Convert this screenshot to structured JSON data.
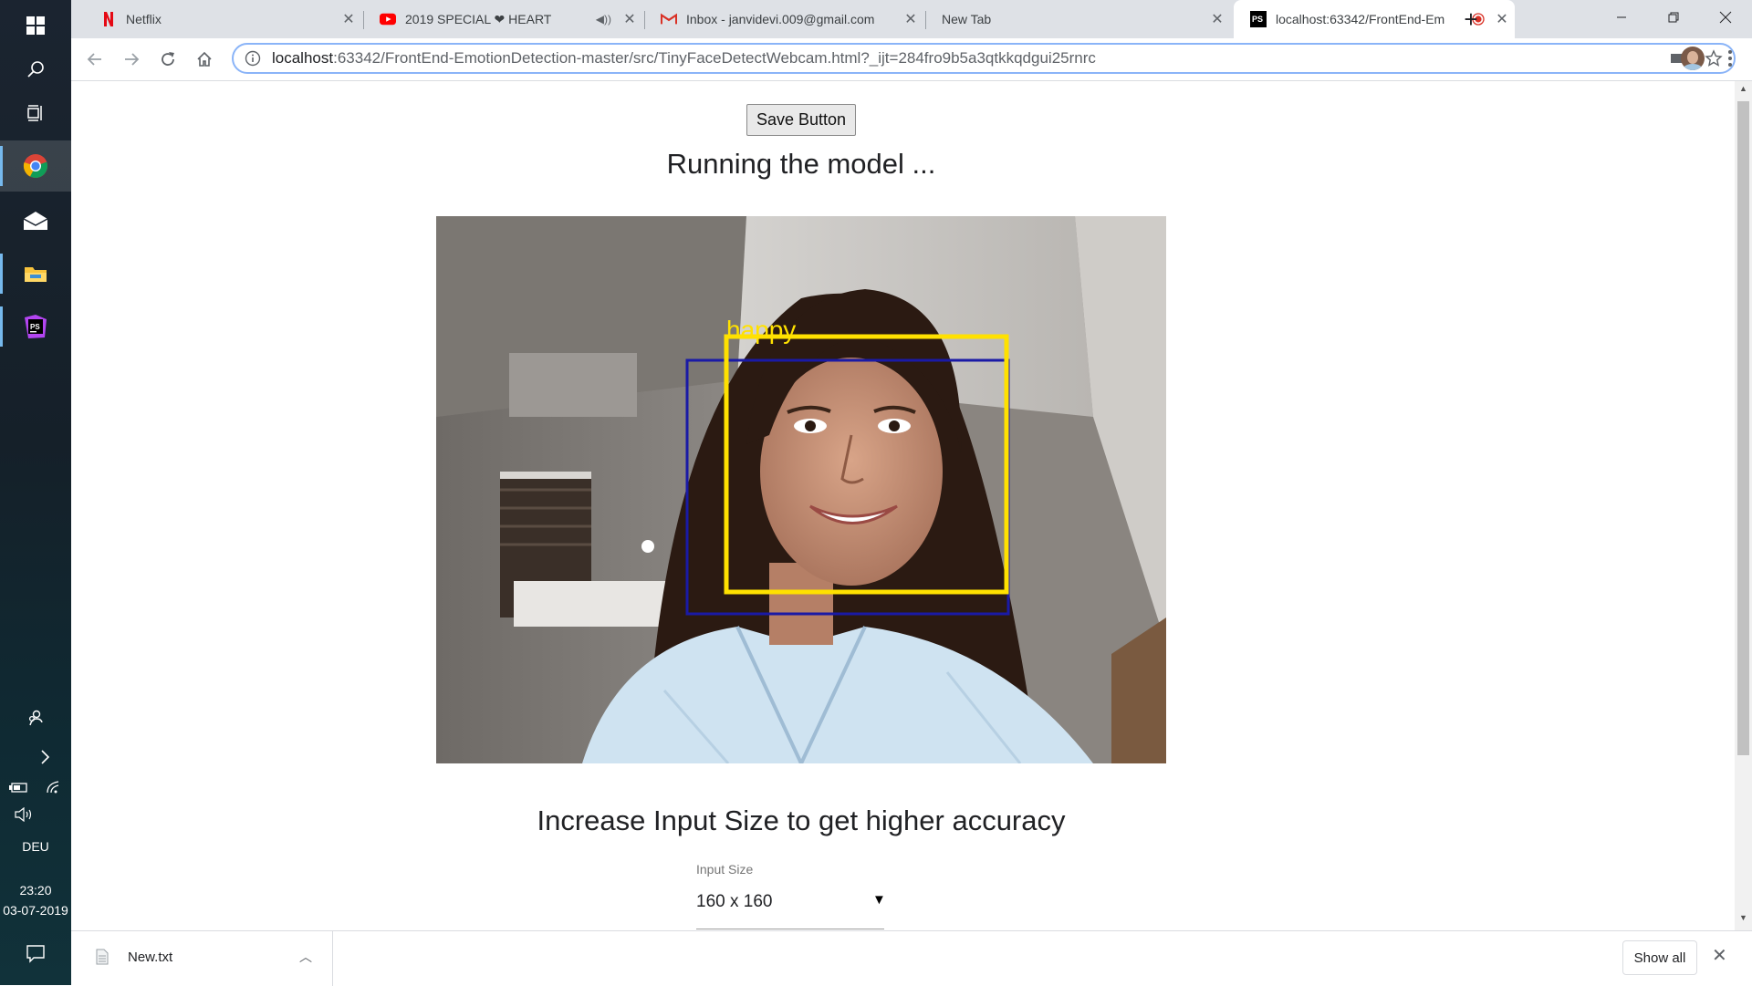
{
  "taskbar": {
    "language": "DEU",
    "time": "23:20",
    "date": "03-07-2019"
  },
  "tabs": [
    {
      "title": "Netflix",
      "favicon": "netflix-icon"
    },
    {
      "title": "2019 SPECIAL ❤ HEART",
      "favicon": "youtube-icon",
      "audio": true
    },
    {
      "title": "Inbox - janvidevi.009@gmail.com",
      "favicon": "gmail-icon"
    },
    {
      "title": "New Tab",
      "favicon": ""
    },
    {
      "title": "localhost:63342/FrontEnd-Em",
      "favicon": "phpstorm-icon",
      "recording": true,
      "active": true
    }
  ],
  "toolbar": {
    "url_host": "localhost",
    "url_rest": ":63342/FrontEnd-EmotionDetection-master/src/TinyFaceDetectWebcam.html?_ijt=284fro9b5a3qtkkqdgui25rnrc"
  },
  "page": {
    "save_label": "Save Button",
    "status": "Running the model ...",
    "emotion_label": "happy",
    "accuracy_heading": "Increase Input Size to get higher accuracy",
    "input_size_label": "Input Size",
    "input_size_value": "160 x 160"
  },
  "downloads": {
    "file_name": "New.txt",
    "show_all": "Show all"
  },
  "colors": {
    "emotion_box": "#ffe100",
    "face_box": "#1a1aa6"
  }
}
